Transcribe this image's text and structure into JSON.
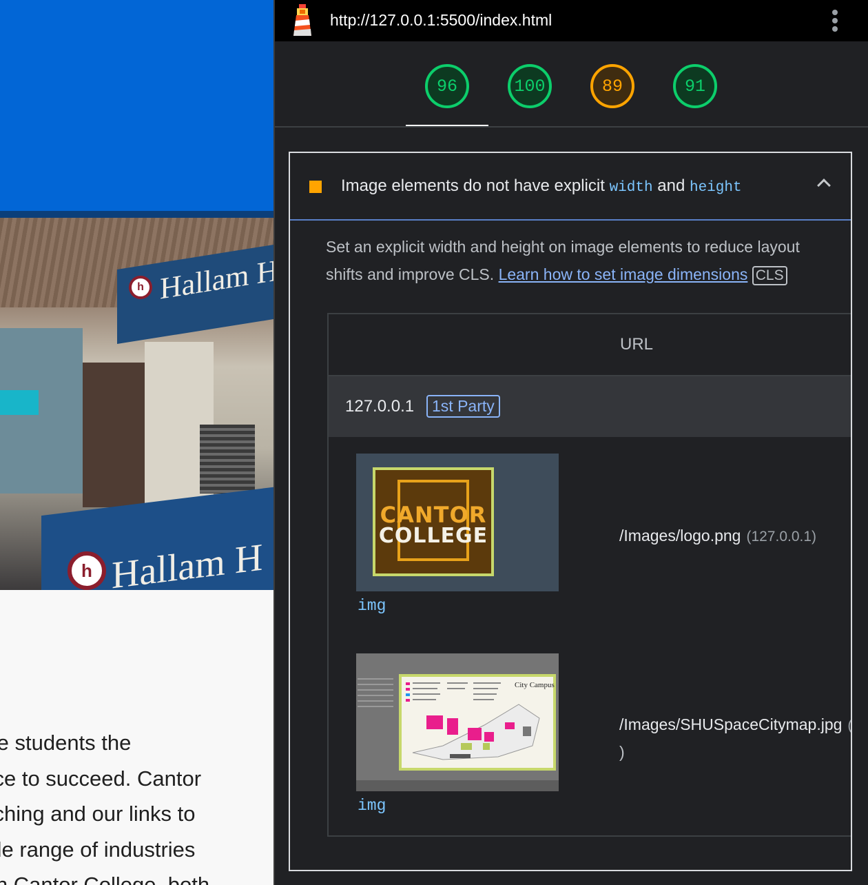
{
  "page": {
    "body_lines": [
      "give students the",
      "ence to succeed. Cantor",
      "eaching and our links to",
      "wide range of industries",
      "with Cantor College, both"
    ],
    "photo_sign_text": "Hallam H"
  },
  "devtools": {
    "url": "http://127.0.0.1:5500/index.html",
    "scores": [
      {
        "value": "96",
        "rating": "good"
      },
      {
        "value": "100",
        "rating": "good"
      },
      {
        "value": "89",
        "rating": "average"
      },
      {
        "value": "91",
        "rating": "good"
      }
    ],
    "colors": {
      "good": "#0cce6b",
      "average": "#ffa400",
      "link": "#8ab4f8",
      "code": "#7cc6ff"
    },
    "audit": {
      "title_prefix": "Image elements do not have explicit ",
      "code1": "width",
      "title_mid": " and ",
      "code2": "height",
      "description": "Set an explicit width and height on image elements to reduce layout shifts and improve CLS. ",
      "link_text": "Learn how to set image dimensions",
      "tag": "CLS",
      "table": {
        "column_header": "URL",
        "entity": "127.0.0.1",
        "entity_badge": "1st Party",
        "items": [
          {
            "node_label": "img",
            "url": "/Images/logo.png",
            "host": "(127.0.0.1)",
            "thumb_line1": "CANTOR",
            "thumb_line2": "COLLEGE"
          },
          {
            "node_label": "img",
            "url": "/Images/SHUSpaceCitymap.jpg",
            "host": "(",
            "tail": ")",
            "thumb_title": "City Campus"
          }
        ]
      }
    }
  }
}
